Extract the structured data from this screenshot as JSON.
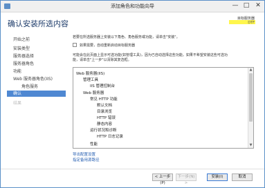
{
  "window": {
    "title": "添加角色和功能向导",
    "controls": {
      "minimize": "—",
      "maximize": "□",
      "close": "✕"
    }
  },
  "header": {
    "title": "确认安装所选内容",
    "destination_label": "目标服务器",
    "destination_value": "DTF"
  },
  "sidebar": {
    "items": [
      {
        "label": "开始之前",
        "state": "normal"
      },
      {
        "label": "安装类型",
        "state": "normal"
      },
      {
        "label": "服务器选择",
        "state": "normal"
      },
      {
        "label": "服务器角色",
        "state": "normal"
      },
      {
        "label": "功能",
        "state": "normal"
      },
      {
        "label": "Web 服务器角色(IIS)",
        "state": "normal"
      },
      {
        "label": "角色服务",
        "state": "normal"
      },
      {
        "label": "确认",
        "state": "active"
      },
      {
        "label": "结果",
        "state": "disabled"
      }
    ]
  },
  "main": {
    "instruction": "若要在所选服务器上安装以下角色、角色服务或功能，请单击\"安装\"。",
    "restart_checkbox": {
      "label": "如果需要，自动重新启动目标服务器",
      "checked": false
    },
    "note_line1": "可能会在此页面上显示可选功能(如管理工具)，因为已自动选择这些功能。如果不希望安装这些可选功",
    "note_line2": "能，请单击\"上一步\"以清除其复选框。",
    "features": [
      {
        "label": "Web 服务器(IIS)",
        "level": 0
      },
      {
        "label": "管理工具",
        "level": 1
      },
      {
        "label": "IIS 管理控制台",
        "level": 2
      },
      {
        "label": "Web 服务器",
        "level": 1
      },
      {
        "label": "常见 HTTP 功能",
        "level": 2
      },
      {
        "label": "默认文档",
        "level": 3
      },
      {
        "label": "目录浏览",
        "level": 3
      },
      {
        "label": "HTTP 错误",
        "level": 3
      },
      {
        "label": "静态内容",
        "level": 3
      },
      {
        "label": "运行状况和诊断",
        "level": 2
      },
      {
        "label": "HTTP 日志记录",
        "level": 3
      },
      {
        "label": "性能",
        "level": 2
      }
    ],
    "links": {
      "export": "导出配置设置",
      "alternate_source": "指定备用源路径"
    }
  },
  "footer": {
    "prev": "< 上一步(P)",
    "next": "下一步(N) >",
    "install": "安装(I)",
    "cancel": "取消"
  },
  "colors": {
    "accent": "#4f88d2",
    "link": "#2a62b3",
    "title": "#1f3d6b",
    "highlight": "#fff200"
  }
}
